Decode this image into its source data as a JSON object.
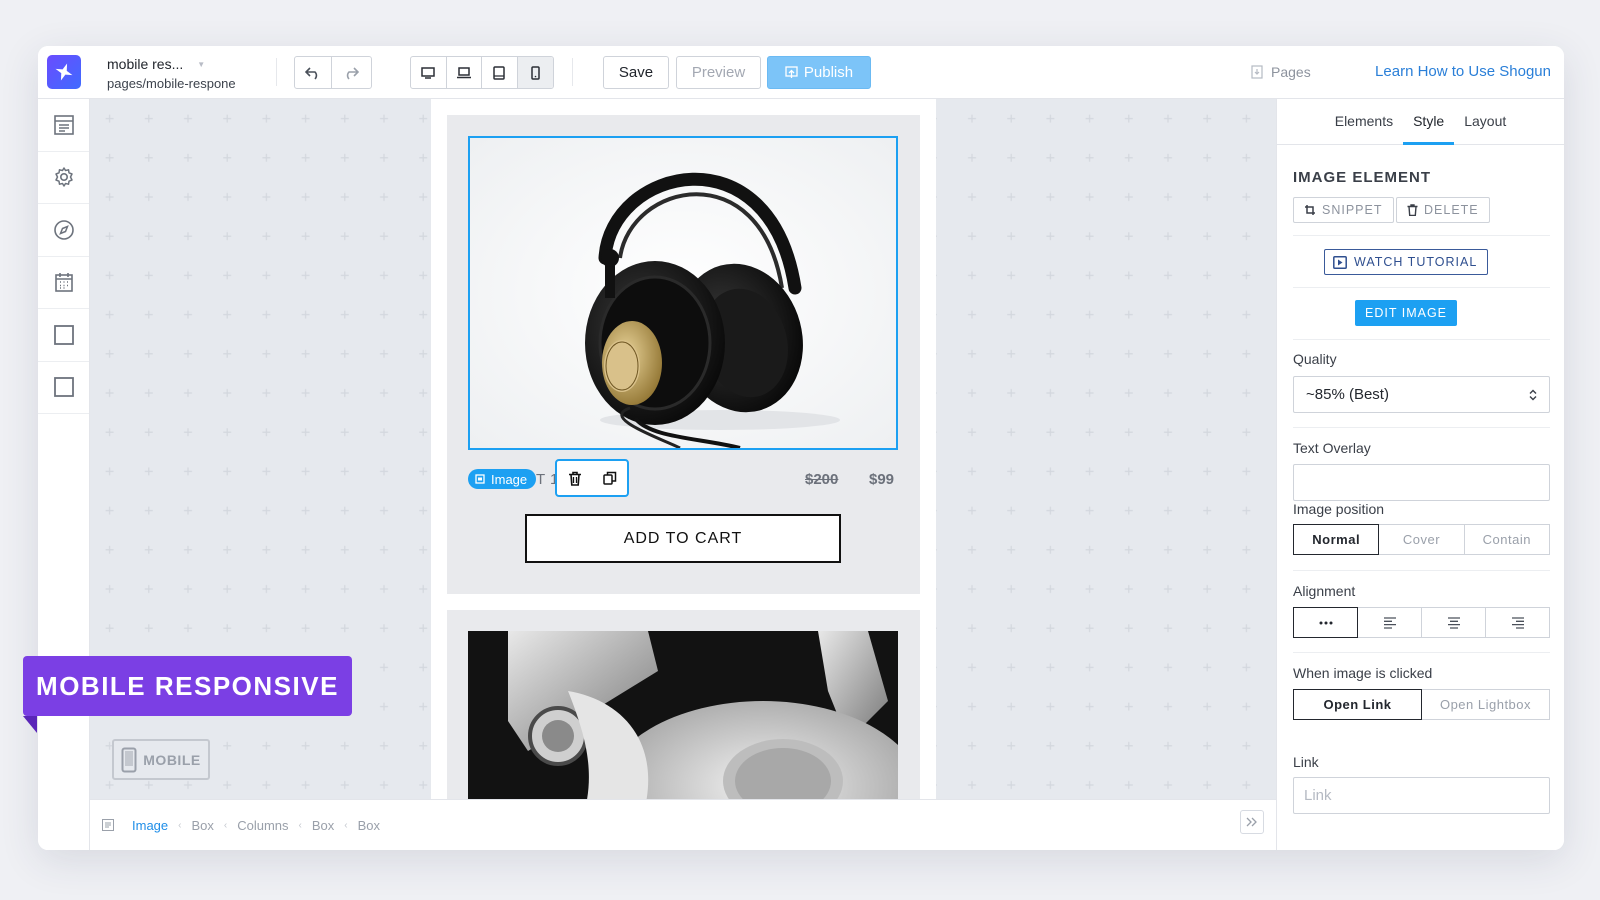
{
  "header": {
    "page_name": "mobile res...",
    "page_path": "pages/mobile-respone",
    "save_label": "Save",
    "preview_label": "Preview",
    "publish_label": "Publish",
    "pages_label": "Pages",
    "learn_label": "Learn How to Use Shogun"
  },
  "canvas": {
    "product_name": "PRODUCT 1",
    "price_old": "$200",
    "price_new": "$99",
    "add_to_cart": "ADD TO CART",
    "image_tag": "Image",
    "mobile_indicator": "MOBILE"
  },
  "breadcrumb": [
    "Image",
    "Box",
    "Columns",
    "Box",
    "Box"
  ],
  "panel": {
    "tabs": [
      "Elements",
      "Style",
      "Layout"
    ],
    "active_tab": "Style",
    "section_title": "IMAGE ELEMENT",
    "snippet_label": "SNIPPET",
    "delete_label": "DELETE",
    "tutorial_label": "WATCH TUTORIAL",
    "edit_image_label": "EDIT IMAGE",
    "quality_label": "Quality",
    "quality_value": "~85% (Best)",
    "text_overlay_label": "Text Overlay",
    "text_overlay_value": "",
    "image_position_label": "Image position",
    "image_position_options": [
      "Normal",
      "Cover",
      "Contain"
    ],
    "image_position_selected": "Normal",
    "alignment_label": "Alignment",
    "when_clicked_label": "When image is clicked",
    "when_clicked_options": [
      "Open Link",
      "Open Lightbox"
    ],
    "when_clicked_selected": "Open Link",
    "link_label": "Link",
    "link_placeholder": "Link"
  },
  "overlay": {
    "badge": "MOBILE RESPONSIVE"
  },
  "colors": {
    "accent": "#1ca0f2",
    "brand": "#5b54f8",
    "badge": "#7b3fe4",
    "link": "#2a7fd8"
  }
}
